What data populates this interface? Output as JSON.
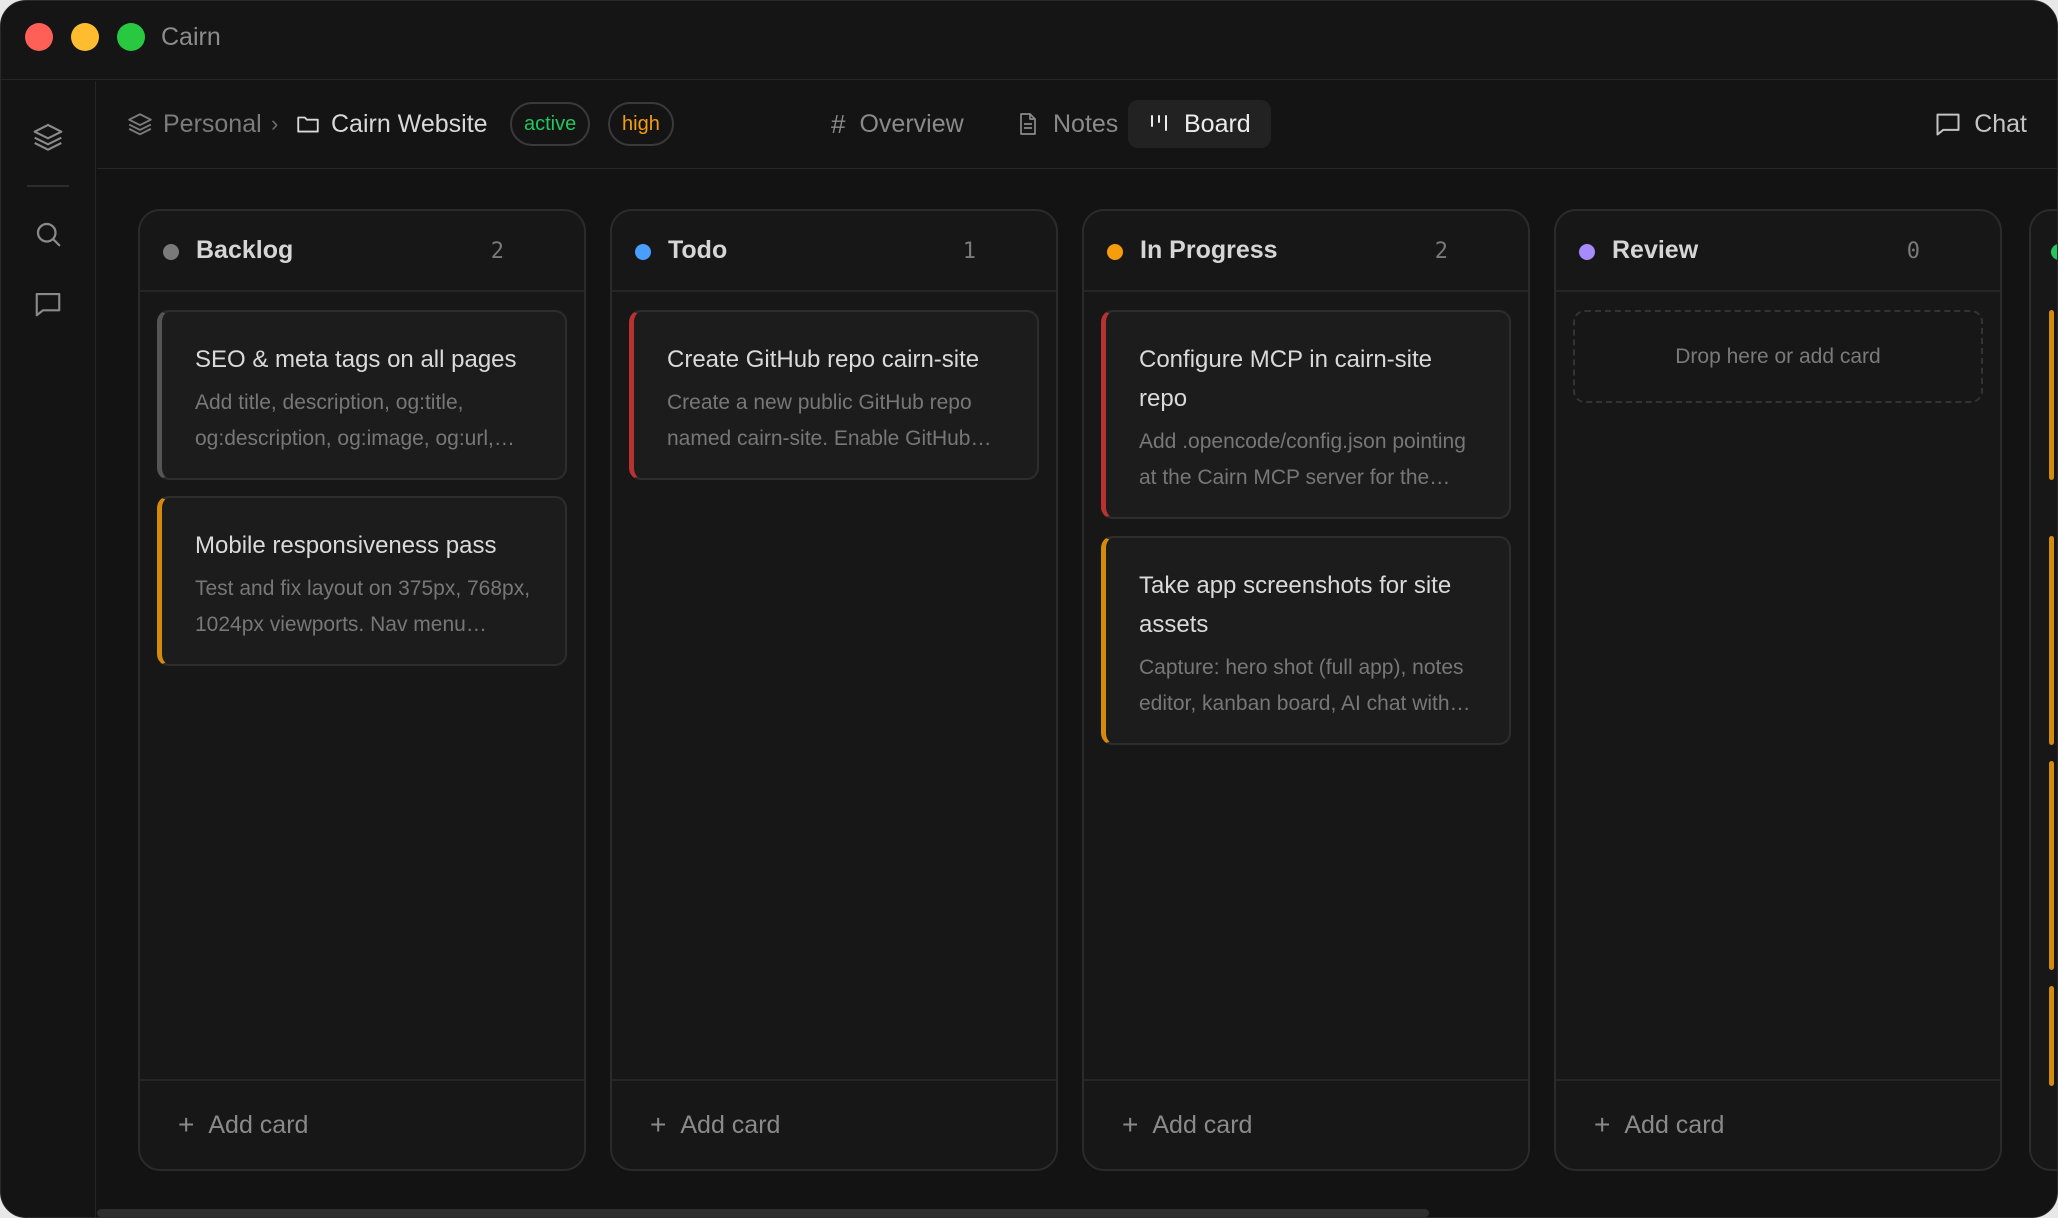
{
  "app": {
    "title": "Cairn"
  },
  "breadcrumb": {
    "workspace": "Personal",
    "project": "Cairn Website"
  },
  "badges": {
    "status": "active",
    "priority": "high"
  },
  "tabs": [
    {
      "label": "Overview",
      "icon": "hash-icon"
    },
    {
      "label": "Notes",
      "icon": "document-icon"
    },
    {
      "label": "Board",
      "icon": "kanban-icon",
      "selected": true
    }
  ],
  "chat": {
    "label": "Chat"
  },
  "colors": {
    "backlog": "#7a7a7a",
    "todo": "#4a9eff",
    "in_progress": "#f59e0b",
    "review": "#a78bfa",
    "done": "#22c55e",
    "priority_red": "#b83232",
    "priority_amber": "#d48a0c"
  },
  "columns": [
    {
      "title": "Backlog",
      "count": "2",
      "add_label": "Add card",
      "cards": [
        {
          "title": "SEO & meta tags on all pages",
          "desc": "Add title, description, og:title, og:description, og:image, og:url, twitter:card"
        },
        {
          "title": "Mobile responsiveness pass",
          "desc": "Test and fix layout on 375px, 768px, 1024px viewports. Nav menu collapse"
        }
      ]
    },
    {
      "title": "Todo",
      "count": "1",
      "add_label": "Add card",
      "cards": [
        {
          "title": "Create GitHub repo cairn-site",
          "desc": "Create a new public GitHub repo named cairn-site. Enable GitHub Pages"
        }
      ]
    },
    {
      "title": "In Progress",
      "count": "2",
      "add_label": "Add card",
      "cards": [
        {
          "title": "Configure MCP in cairn-site repo",
          "desc": "Add .opencode/config.json pointing at the Cairn MCP server for the agent"
        },
        {
          "title": "Take app screenshots for site assets",
          "desc": "Capture: hero shot (full app), notes editor, kanban board, AI chat with context"
        }
      ]
    },
    {
      "title": "Review",
      "count": "0",
      "add_label": "Add card",
      "dropzone": "Drop here or add card"
    }
  ]
}
